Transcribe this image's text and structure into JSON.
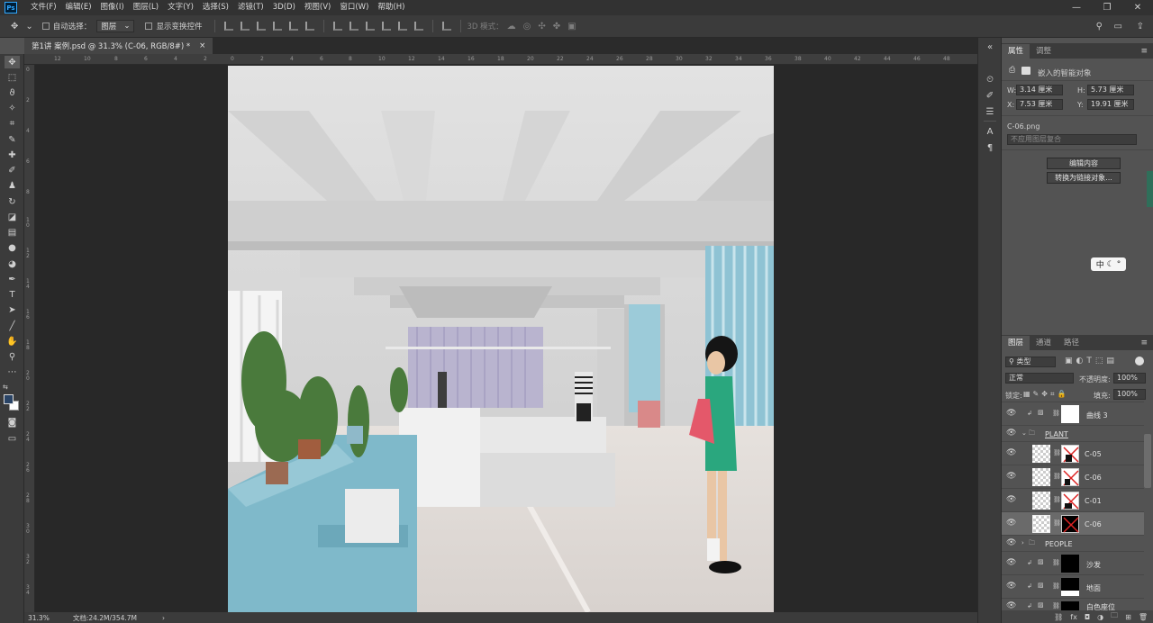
{
  "menubar": {
    "logo": "Ps",
    "items": [
      "文件(F)",
      "编辑(E)",
      "图像(I)",
      "图层(L)",
      "文字(Y)",
      "选择(S)",
      "滤镜(T)",
      "3D(D)",
      "视图(V)",
      "窗口(W)",
      "帮助(H)"
    ],
    "window_controls": [
      "—",
      "❐",
      "✕"
    ]
  },
  "optionsbar": {
    "auto_select_label": "自动选择：",
    "auto_select_value": "图层",
    "show_transform_label": "显示变换控件",
    "mode_3d_label": "3D 模式："
  },
  "document": {
    "tab_title": "第1讲 案例.psd @ 31.3% (C-06, RGB/8#) *",
    "close": "×"
  },
  "status": {
    "zoom": "31.3%",
    "doc_size": "文档:24.2M/354.7M",
    "arrow": "›"
  },
  "ruler": {
    "top": [
      "12",
      "10",
      "8",
      "6",
      "4",
      "2",
      "0",
      "2",
      "4",
      "6",
      "8",
      "10",
      "12",
      "14",
      "16",
      "18",
      "20",
      "22",
      "24",
      "26",
      "28",
      "30",
      "32",
      "34",
      "36",
      "38",
      "40",
      "42",
      "44",
      "46",
      "48"
    ],
    "left": [
      "0",
      "2",
      "4",
      "6",
      "8",
      "1 0",
      "1 2",
      "1 4",
      "1 6",
      "1 8",
      "2 0",
      "2 2",
      "2 4",
      "2 6",
      "2 8",
      "3 0",
      "3 2",
      "3 4"
    ]
  },
  "properties": {
    "tabs": [
      "属性",
      "调整"
    ],
    "header": "嵌入的智能对象",
    "w_label": "W:",
    "w_value": "3.14 厘米",
    "h_label": "H:",
    "h_value": "5.73 厘米",
    "x_label": "X:",
    "x_value": "7.53 厘米",
    "y_label": "Y:",
    "y_value": "19.91 厘米",
    "filename": "C-06.png",
    "comp_placeholder": "不应用图层复合",
    "edit_button": "编辑内容",
    "convert_button": "转换为链接对象..."
  },
  "ime": {
    "label": "中"
  },
  "layers": {
    "tabs": [
      "图层",
      "通道",
      "路径"
    ],
    "filter_type": "类型",
    "blend_mode": "正常",
    "opacity_label": "不透明度:",
    "opacity_value": "100%",
    "lock_label": "锁定:",
    "fill_label": "填充:",
    "fill_value": "100%",
    "rows": [
      {
        "name": "曲线 3"
      },
      {
        "name": "PLANT"
      },
      {
        "name": "C-05"
      },
      {
        "name": "C-06"
      },
      {
        "name": "C-01"
      },
      {
        "name": "C-06"
      },
      {
        "name": "PEOPLE"
      },
      {
        "name": "沙发"
      },
      {
        "name": "地面"
      },
      {
        "name": "白色座位"
      }
    ],
    "footer_icons": [
      "link-icon",
      "fx-icon",
      "mask-icon",
      "adjustment-icon",
      "group-icon",
      "new-layer-icon",
      "trash-icon"
    ]
  }
}
